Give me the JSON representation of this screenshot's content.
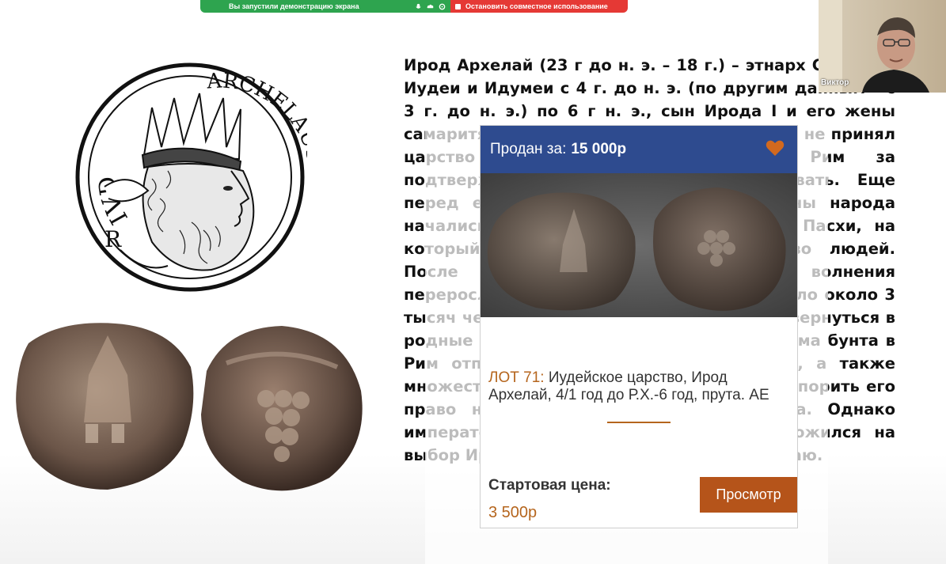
{
  "share_bar": {
    "status_text": "Вы запустили демонстрацию экрана",
    "stop_label": "Остановить совместное использование",
    "bg_color": "#2ea44f",
    "stop_color": "#e53935"
  },
  "slide": {
    "text_lead": "Ирод Архелай",
    "text_body": " (23 г до н. э. – 18 г.) – этнарх Самарии, Иудеи и Идумеи с 4 г. до н. э. (по другим данным – с 3 г. до н. э.) по 6 г н. э., сын Ирода I и его жены самаритянки. После смерти Ирода Архелай не принял царство сразу, а направился в Рим за подтверждением своего права царствовать. Еще перед его отъездом в Иудее со стороны народа начались волнения во время праздника Пасхи, на который стекалось огромное количество людей. После нескольких попыток усмирить волнения переросли в бунт, в результате чего погибло около 3 тысяч человек, остальным же разрешили вернуться в родные края к своим делам. После разгрома бунта в Рим отправились его брат Ирод Антипа, а также множества противников Архелая, чтобы оспорить его право на наследование престола Ирода. Однако император, выслушав обе стороны, положился на выбор Ирода и отдал предпочтение Архелаю.",
    "engraving_text_left": "IVD",
    "engraving_text_right": "ARCHELAUS",
    "engraving_text_r": "R"
  },
  "lot_card": {
    "sold_label": "Продан за:",
    "sold_price": "15 000р",
    "lot_number": "ЛОТ 71:",
    "lot_title": "Иудейское царство, Ирод Архелай, 4/1 год до Р.Х.-6 год, прута. АЕ",
    "start_label": "Стартовая цена:",
    "start_price": "3 500р",
    "view_button": "Просмотр",
    "header_color": "#2e4b8f",
    "accent_color": "#b5651d",
    "button_color": "#b5541a",
    "heart_icon": "heart-icon"
  },
  "webcam": {
    "participant_name": "Виктор"
  }
}
